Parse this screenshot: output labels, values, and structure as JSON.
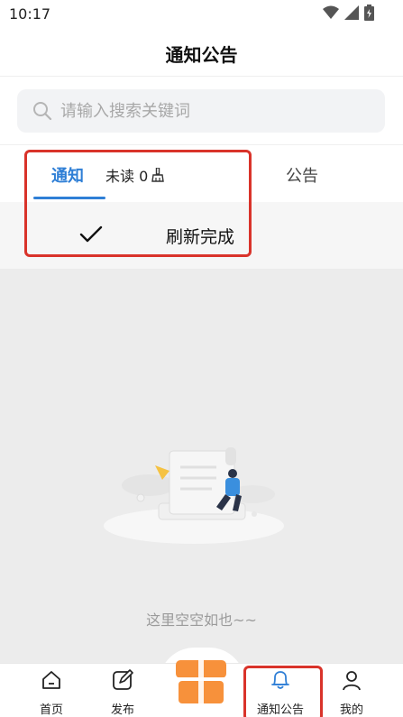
{
  "status_bar": {
    "time": "10:17",
    "icons": [
      "wifi-icon",
      "signal-icon",
      "battery-icon"
    ]
  },
  "header": {
    "title": "通知公告"
  },
  "search": {
    "placeholder": "请输入搜索关键词",
    "value": ""
  },
  "tabs": {
    "notice_label": "通知",
    "unread_label": "未读 0",
    "announcement_label": "公告",
    "active": "通知"
  },
  "refresh": {
    "status_text": "刷新完成"
  },
  "empty_state": {
    "text": "这里空空如也~~"
  },
  "bottom_nav": {
    "items": [
      {
        "label": "首页",
        "icon": "home-icon"
      },
      {
        "label": "发布",
        "icon": "edit-icon"
      },
      {
        "label": "",
        "icon": "gift-box-icon"
      },
      {
        "label": "通知公告",
        "icon": "bell-icon",
        "active": true
      },
      {
        "label": "我的",
        "icon": "user-icon"
      }
    ]
  },
  "colors": {
    "accent": "#2f7fd6",
    "highlight_box": "#d9332a",
    "center_button": "#f7913b"
  }
}
